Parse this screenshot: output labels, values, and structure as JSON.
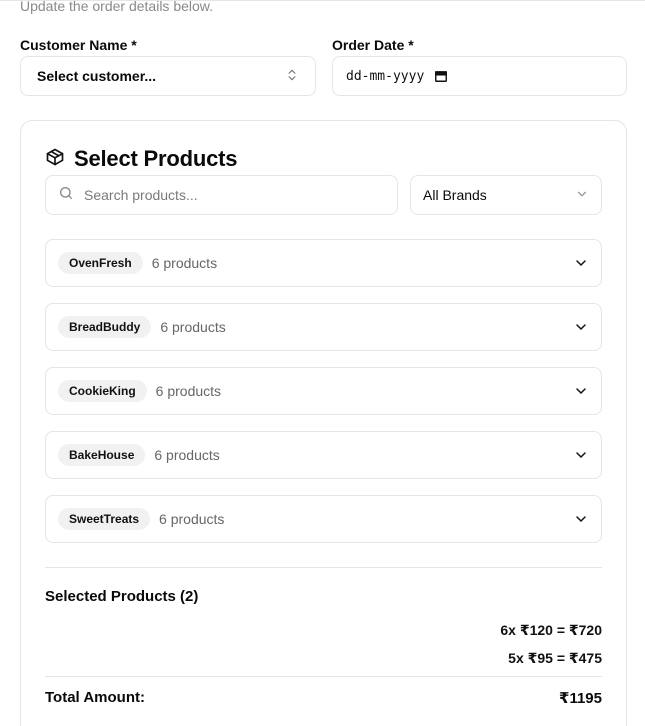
{
  "header": {
    "subtitle": "Update the order details below."
  },
  "form": {
    "customer_label": "Customer Name *",
    "customer_value": "Select customer...",
    "date_label": "Order Date *",
    "date_value": "dd-mm-yyyy"
  },
  "products": {
    "title": "Select Products",
    "search_placeholder": "Search products...",
    "brand_filter": "All Brands",
    "groups": [
      {
        "brand": "OvenFresh",
        "count": "6 products"
      },
      {
        "brand": "BreadBuddy",
        "count": "6 products"
      },
      {
        "brand": "CookieKing",
        "count": "6 products"
      },
      {
        "brand": "BakeHouse",
        "count": "6 products"
      },
      {
        "brand": "SweetTreats",
        "count": "6 products"
      }
    ]
  },
  "selected": {
    "title": "Selected Products (2)",
    "lines": [
      "6x ₹120 = ₹720",
      "5x ₹95 = ₹475"
    ],
    "total_label": "Total Amount:",
    "total_value": "₹1195"
  },
  "icons": {
    "up-down": "chevrons-up-down-icon",
    "calendar": "calendar-icon",
    "package": "package-icon",
    "search": "search-icon",
    "chevron": "chevron-down-icon"
  },
  "colors": {
    "border": "#e5e5e5",
    "badge_bg": "#f1f1f1",
    "muted_text": "#666666"
  }
}
